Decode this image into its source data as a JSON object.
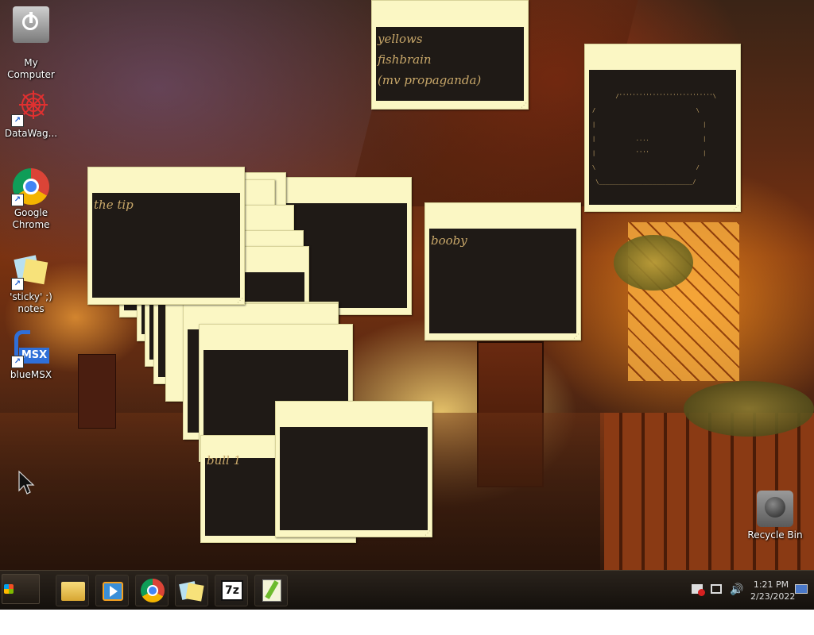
{
  "desktop_icons": [
    {
      "name": "my-computer",
      "label": "My\nComputer",
      "icon": "computer-power-icon"
    },
    {
      "name": "datawag",
      "label": "DataWag...",
      "icon": "red-starburst-icon"
    },
    {
      "name": "google-chrome",
      "label": "Google\nChrome",
      "icon": "chrome-icon"
    },
    {
      "name": "sticky-notes",
      "label": "'sticky' ;)\nnotes",
      "icon": "sticky-notes-icon"
    },
    {
      "name": "bluemsx",
      "label": "blueMSX",
      "icon": "bluemsx-icon"
    },
    {
      "name": "recycle-bin",
      "label": "Recycle Bin",
      "icon": "recycle-bin-icon"
    }
  ],
  "shortcut_arrow": "↗",
  "notes": {
    "top": {
      "lines": [
        "yellows",
        "fishbrain",
        "(mv propaganda)"
      ]
    },
    "the_tip": {
      "text": "the tip"
    },
    "booby": {
      "text": "booby"
    },
    "partial": {
      "text": "bull 1"
    },
    "ascii": {
      "art": " /''''''''''''''''''''''''''''\\\n/                              \\\n|                                |\n|            ....                |\n|            ''''                |\n\\                              /\n \\____________________________/"
    }
  },
  "grip": "⋰",
  "taskbar": {
    "start_label": "Start",
    "apps": [
      {
        "name": "file-explorer",
        "icon": "folder-icon"
      },
      {
        "name": "media-player",
        "icon": "media-player-icon"
      },
      {
        "name": "chrome",
        "icon": "chrome-icon"
      },
      {
        "name": "sticky-notes",
        "icon": "sticky-notes-icon"
      },
      {
        "name": "7zip",
        "icon": "7zip-icon",
        "glyph": "7z"
      },
      {
        "name": "notepad-plus",
        "icon": "notepad-icon"
      }
    ],
    "clock": {
      "time": "1:21 PM",
      "date": "2/23/2022"
    }
  },
  "colors": {
    "note_frame": "#fbf7c4",
    "note_pane": "#1f1a16",
    "note_text": "#c9a86a"
  }
}
